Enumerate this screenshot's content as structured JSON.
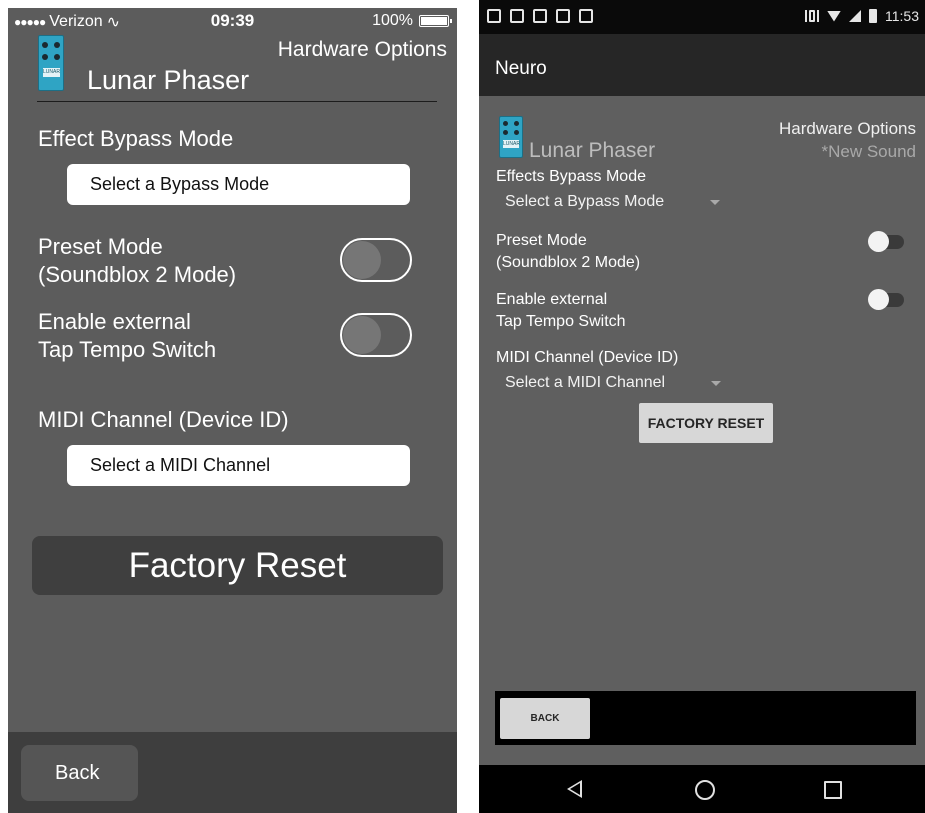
{
  "ios": {
    "status": {
      "carrier": "Verizon",
      "time": "09:39",
      "battery": "100%"
    },
    "header": {
      "title": "Hardware Options",
      "pedal_name": "Lunar Phaser",
      "pedal_icon": "lunar-phaser-pedal-icon",
      "pedal_icon_text": "LUNAR"
    },
    "bypass": {
      "label": "Effect Bypass Mode",
      "select": "Select a Bypass Mode"
    },
    "preset": {
      "label_line1": "Preset Mode",
      "label_line2": "(Soundblox 2 Mode)",
      "on": false
    },
    "tap": {
      "label_line1": "Enable external",
      "label_line2": "Tap Tempo Switch",
      "on": false
    },
    "midi": {
      "label": "MIDI Channel (Device ID)",
      "select": "Select a MIDI Channel"
    },
    "factory_reset": "Factory Reset",
    "back": "Back"
  },
  "android": {
    "status": {
      "time": "11:53"
    },
    "app_title": "Neuro",
    "header": {
      "title": "Hardware Options",
      "subtitle": "*New Sound",
      "pedal_name": "Lunar Phaser",
      "pedal_icon_text": "LUNAR"
    },
    "bypass": {
      "label": "Effects Bypass Mode",
      "select": "Select a Bypass Mode"
    },
    "preset": {
      "label_line1": "Preset Mode",
      "label_line2": "(Soundblox 2 Mode)",
      "on": false
    },
    "tap": {
      "label_line1": "Enable external",
      "label_line2": "Tap Tempo Switch",
      "on": false
    },
    "midi": {
      "label": "MIDI Channel (Device ID)",
      "select": "Select a MIDI Channel"
    },
    "factory_reset": "FACTORY RESET",
    "back": "BACK"
  }
}
